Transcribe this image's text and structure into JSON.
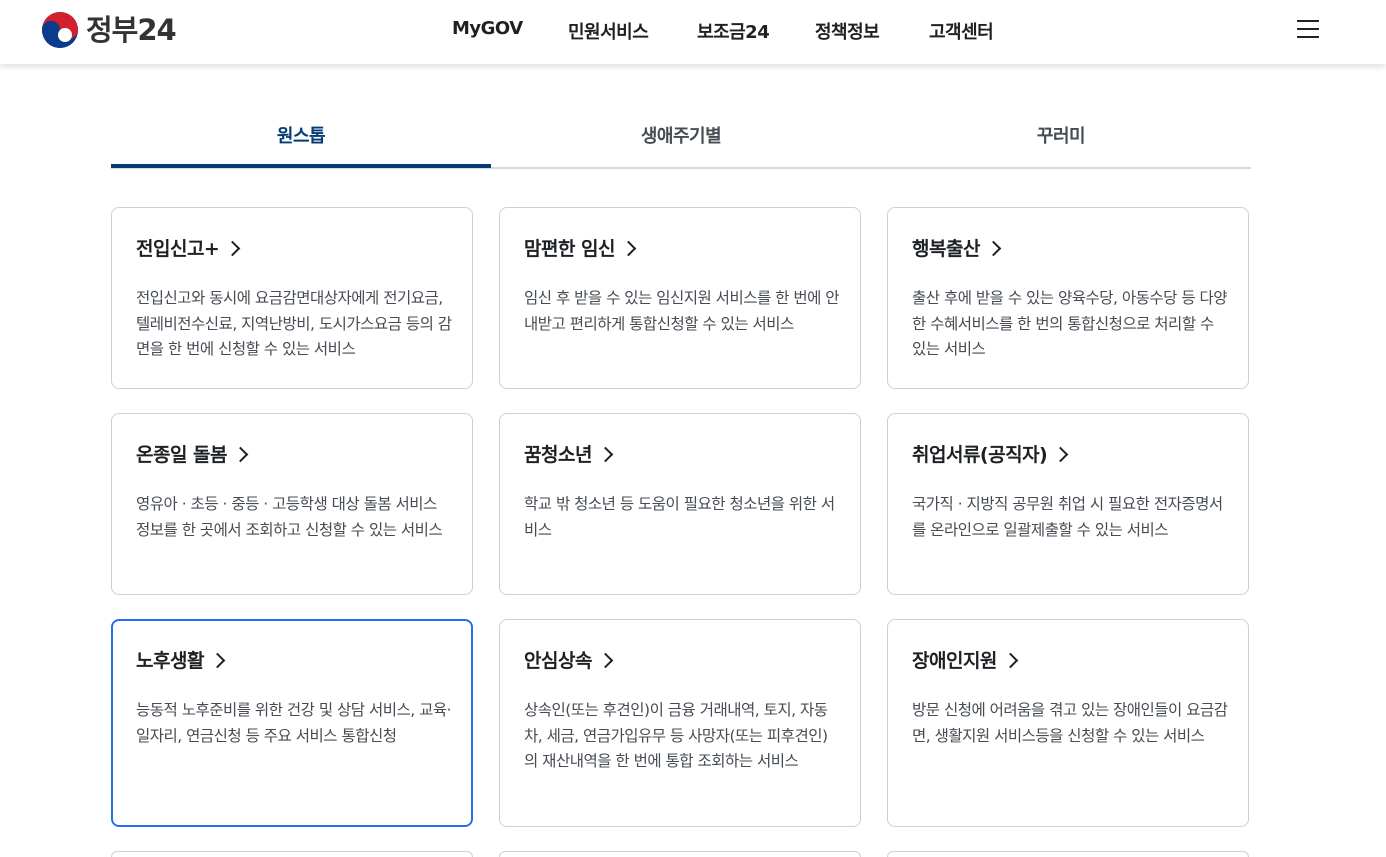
{
  "header": {
    "logo_text": "정부24",
    "nav": [
      "MyGOV",
      "민원서비스",
      "보조금24",
      "정책정보",
      "고객센터"
    ],
    "menu_icon": "hamburger-menu-icon"
  },
  "tabs": [
    {
      "label": "원스톱",
      "active": true
    },
    {
      "label": "생애주기별",
      "active": false
    },
    {
      "label": "꾸러미",
      "active": false
    }
  ],
  "cards": [
    {
      "title": "전입신고+",
      "desc": "전입신고와 동시에 요금감면대상자에게 전기요금, 텔레비전수신료, 지역난방비, 도시가스요금 등의 감면을 한 번에 신청할 수 있는 서비스"
    },
    {
      "title": "맘편한 임신",
      "desc": "임신 후 받을 수 있는 임신지원 서비스를 한 번에 안내받고 편리하게 통합신청할 수 있는 서비스"
    },
    {
      "title": "행복출산",
      "desc": "출산 후에 받을 수 있는 양육수당, 아동수당 등 다양한 수혜서비스를 한 번의 통합신청으로 처리할 수 있는 서비스"
    },
    {
      "title": "온종일 돌봄",
      "desc": "영유아 · 초등 · 중등 · 고등학생 대상 돌봄 서비스 정보를 한 곳에서 조회하고 신청할 수 있는 서비스"
    },
    {
      "title": "꿈청소년",
      "desc": "학교 밖 청소년 등 도움이 필요한 청소년을 위한 서비스"
    },
    {
      "title": "취업서류(공직자)",
      "desc": "국가직 · 지방직 공무원 취업 시 필요한 전자증명서를 온라인으로 일괄제출할 수 있는 서비스"
    },
    {
      "title": "노후생활",
      "desc": "능동적 노후준비를 위한 건강 및 상담 서비스, 교육·일자리, 연금신청 등 주요 서비스 통합신청"
    },
    {
      "title": "안심상속",
      "desc": "상속인(또는 후견인)이 금융 거래내역, 토지, 자동차, 세금, 연금가입유무 등 사망자(또는 피후견인)의 재산내역을 한 번에 통합 조회하는 서비스"
    },
    {
      "title": "장애인지원",
      "desc": "방문 신청에 어려움을 겪고 있는 장애인들이 요금감면, 생활지원 서비스등을 신청할 수 있는 서비스"
    }
  ],
  "colors": {
    "accent": "#063a74",
    "focus": "#256ef4"
  }
}
